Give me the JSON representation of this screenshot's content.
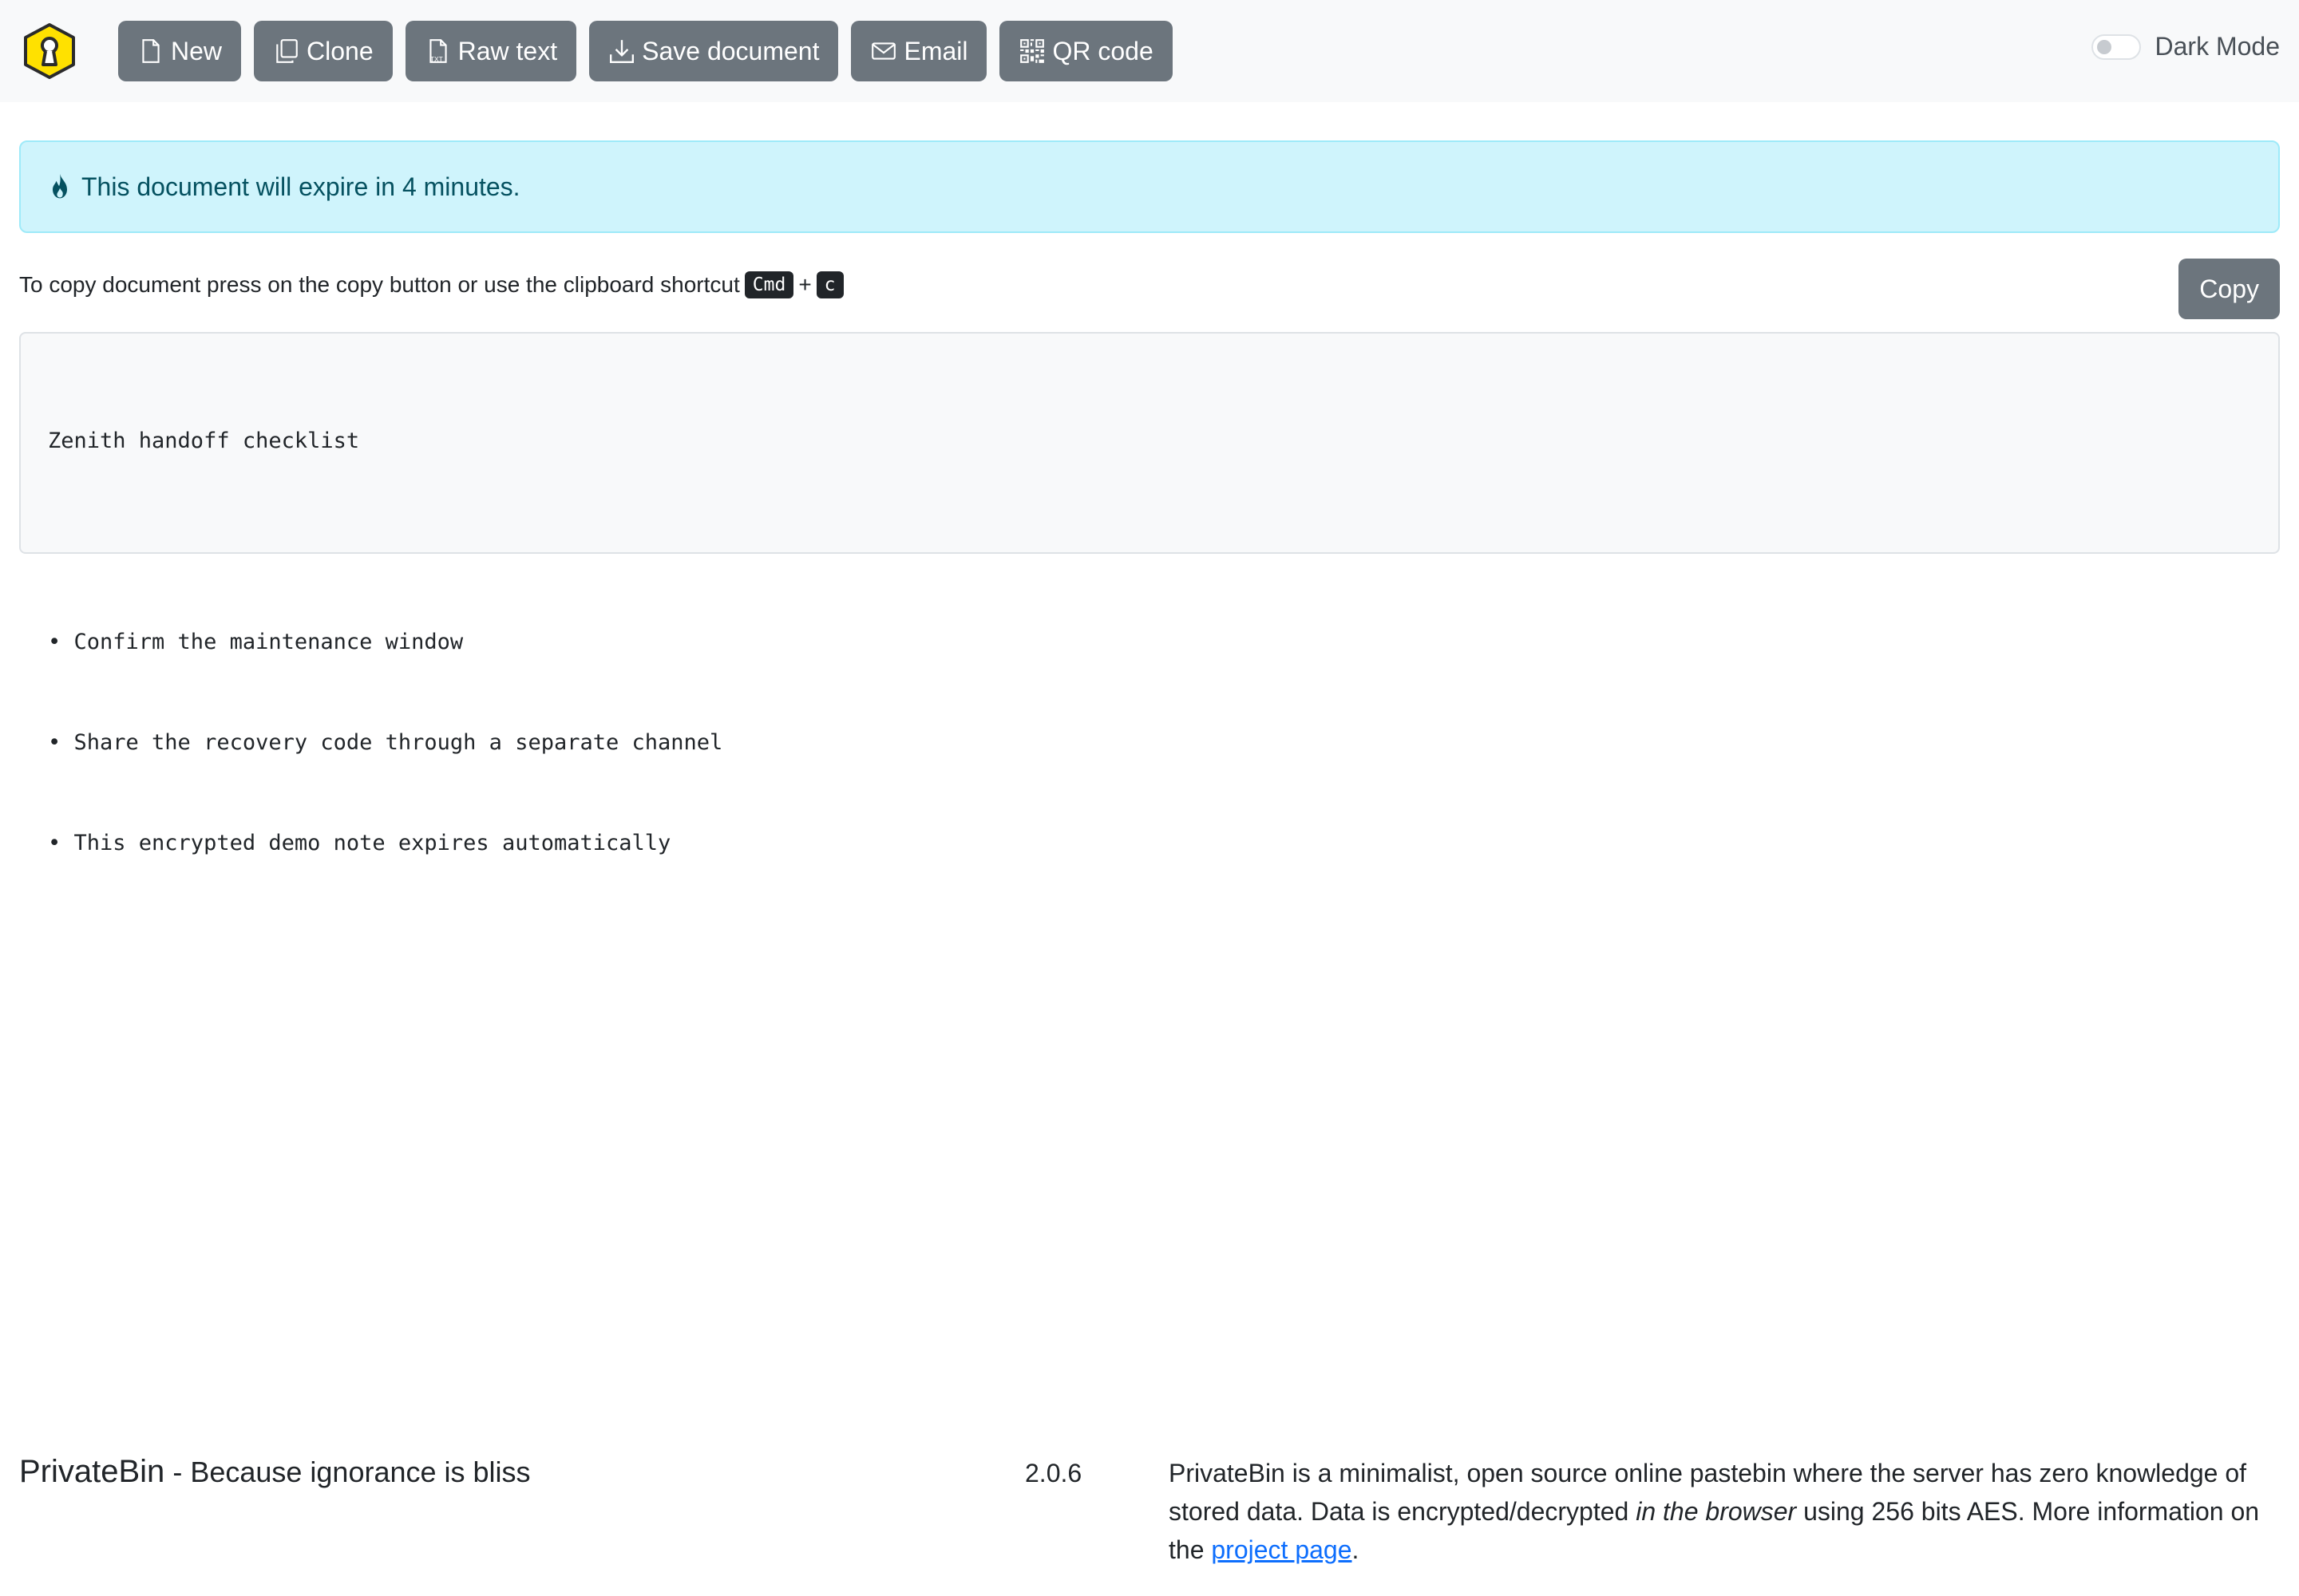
{
  "navbar": {
    "logo_icon": "keyhole-hexagon-logo",
    "buttons": [
      {
        "label": "New",
        "icon": "file-icon"
      },
      {
        "label": "Clone",
        "icon": "copy-icon"
      },
      {
        "label": "Raw text",
        "icon": "txt-file-icon"
      },
      {
        "label": "Save document",
        "icon": "download-icon"
      },
      {
        "label": "Email",
        "icon": "envelope-icon"
      },
      {
        "label": "QR code",
        "icon": "qr-code-icon"
      }
    ],
    "dark_mode": {
      "label": "Dark Mode",
      "enabled": false
    }
  },
  "alert": {
    "icon": "fire-icon",
    "text": "This document will expire in 4 minutes."
  },
  "copy_hint": {
    "text": "To copy document press on the copy button or use the clipboard shortcut",
    "key1": "Cmd",
    "plus": "+",
    "key2": "c",
    "button_label": "Copy"
  },
  "document": {
    "lines": [
      "Zenith handoff checklist",
      "",
      "• Confirm the maintenance window",
      "• Share the recovery code through a separate channel",
      "• This encrypted demo note expires automatically"
    ]
  },
  "footer": {
    "brand_name": "PrivateBin",
    "brand_separator": "-",
    "tagline": "Because ignorance is bliss",
    "version": "2.0.6",
    "about_part1": "PrivateBin is a minimalist, open source online pastebin where the server has zero knowledge of stored data. Data is encrypted/decrypted ",
    "about_emphasis": "in the browser",
    "about_part2": " using 256 bits AES. More information on the ",
    "about_link": "project page",
    "about_end": "."
  },
  "colors": {
    "button_bg": "#6c757d",
    "navbar_bg": "#f8f9fa",
    "alert_bg": "#cff4fc",
    "alert_text": "#055160",
    "link": "#0d6efd",
    "logo_yellow": "#ffe100"
  }
}
